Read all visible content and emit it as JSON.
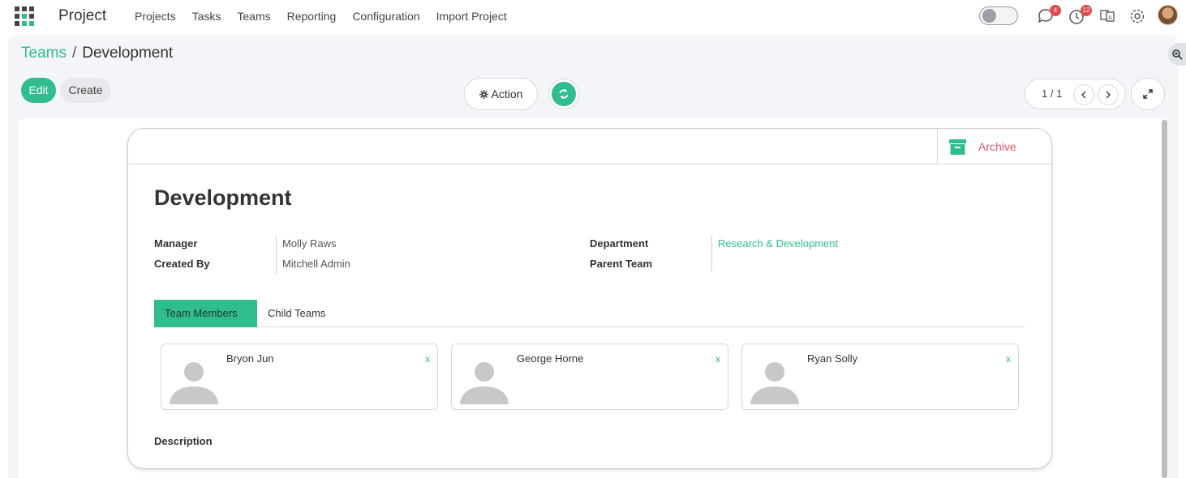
{
  "navbar": {
    "app_title": "Project",
    "menu": [
      "Projects",
      "Tasks",
      "Teams",
      "Reporting",
      "Configuration",
      "Import Project"
    ],
    "messages_badge": "4",
    "activities_badge": "12",
    "icons": [
      "apps-grid-icon",
      "chat-icon",
      "clock-icon",
      "language-icon",
      "gear-icon",
      "user-avatar"
    ]
  },
  "breadcrumb": {
    "parent": "Teams",
    "separator": "/",
    "current": "Development"
  },
  "buttons": {
    "edit": "Edit",
    "create": "Create",
    "action": "Action"
  },
  "pager": {
    "value": "1 / 1"
  },
  "record": {
    "archive_label": "Archive",
    "title": "Development",
    "fields": {
      "manager_label": "Manager",
      "manager_value": "Molly Raws",
      "created_by_label": "Created By",
      "created_by_value": "Mitchell Admin",
      "department_label": "Department",
      "department_value": "Research & Development",
      "parent_team_label": "Parent Team",
      "parent_team_value": ""
    },
    "tabs": [
      {
        "label": "Team Members",
        "active": true
      },
      {
        "label": "Child Teams",
        "active": false
      }
    ],
    "members": [
      {
        "name": "Bryon Jun",
        "remove": "x"
      },
      {
        "name": "George Horne",
        "remove": "x"
      },
      {
        "name": "Ryan Solly",
        "remove": "x"
      }
    ],
    "description_label": "Description"
  },
  "colors": {
    "accent": "#2fbc8f",
    "archive": "#e05a68",
    "badge": "#e04b4b"
  }
}
